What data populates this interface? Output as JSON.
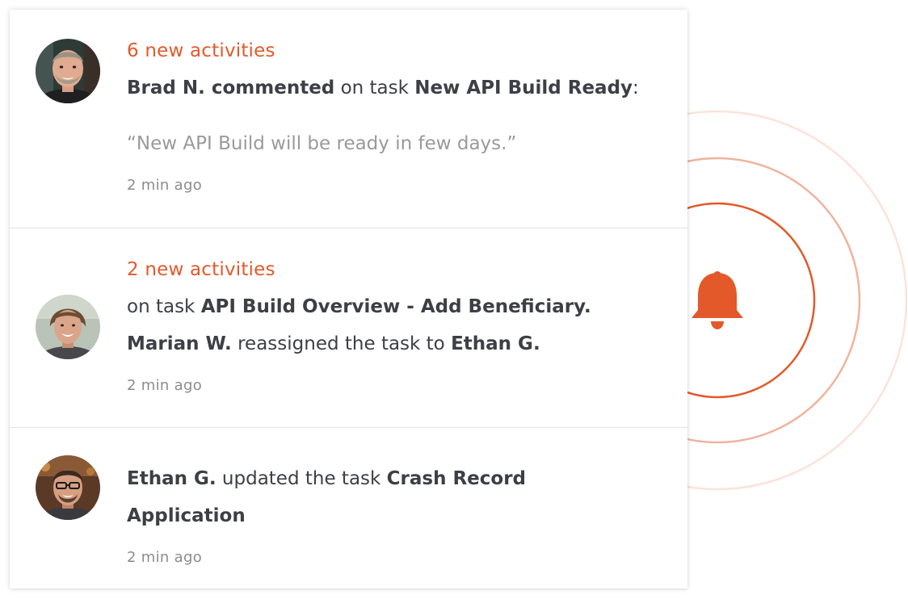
{
  "colors": {
    "accent": "#e3592a",
    "text": "#3d3f45",
    "muted": "#9a9a9a"
  },
  "bell": {
    "icon": "bell-icon"
  },
  "notifications": [
    {
      "activity_count": "6 new activities",
      "actor": "Brad N.",
      "action": " commented",
      "middle": " on task ",
      "task": "New API Build Ready",
      "suffix": ":",
      "quote": "“New API Build will be ready in few days.”",
      "time": "2 min ago"
    },
    {
      "activity_count": "2 new activities",
      "line1_prefix": "on task ",
      "line1_task": "API Build Overview - Add Beneficiary.",
      "actor": "Marian W.",
      "action": " reassigned the task to ",
      "target": "Ethan G.",
      "time": "2 min ago"
    },
    {
      "actor": "Ethan G.",
      "action": " updated the task ",
      "task_part1": "Crash Record",
      "task_part2": "Application",
      "time": "2 min ago"
    }
  ]
}
